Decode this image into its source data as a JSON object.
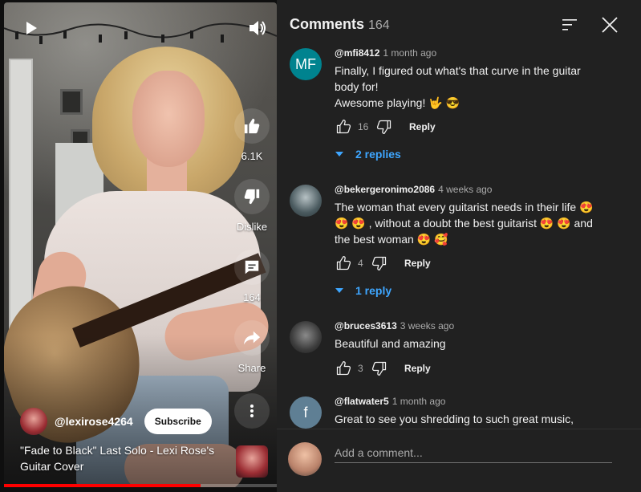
{
  "video": {
    "channel_name": "@lexirose4264",
    "subscribe_label": "Subscribe",
    "title": "\"Fade to Black\" Last Solo - Lexi Rose's Guitar Cover",
    "progress_fraction": 0.72,
    "actions": {
      "like_label": "6.1K",
      "dislike_label": "Dislike",
      "comments_label": "164",
      "share_label": "Share"
    },
    "accent_color": "#ff0000"
  },
  "comments_panel": {
    "title": "Comments",
    "count": "164",
    "input_placeholder": "Add a comment...",
    "reply_label": "Reply",
    "items": [
      {
        "author": "@mfi8412",
        "time": "1 month ago",
        "avatar_initials": "MF",
        "avatar_color": "#00838f",
        "text": "Finally, I figured out what's that curve in the guitar\nbody for!\nAwesome playing! 🤟 😎",
        "likes": "16",
        "replies": "2 replies"
      },
      {
        "author": "@bekergeronimo2086",
        "time": "4 weeks ago",
        "avatar_initials": "",
        "avatar_color": "#3a4a4f",
        "text": "The woman that every guitarist needs in their life 😍\n😍 😍 , without a doubt the best guitarist 😍 😍  and\nthe best woman 😍 🥰",
        "likes": "4",
        "replies": "1 reply"
      },
      {
        "author": "@bruces3613",
        "time": "3 weeks ago",
        "avatar_initials": "",
        "avatar_color": "#4a4a4a",
        "text": "Beautiful and amazing",
        "likes": "3",
        "replies": ""
      },
      {
        "author": "@flatwater5",
        "time": "1 month ago",
        "avatar_initials": "f",
        "avatar_color": "#5f7f94",
        "text": "Great to see you shredding to such great music,",
        "likes": "",
        "replies": ""
      }
    ],
    "link_color": "#3ea6ff"
  }
}
